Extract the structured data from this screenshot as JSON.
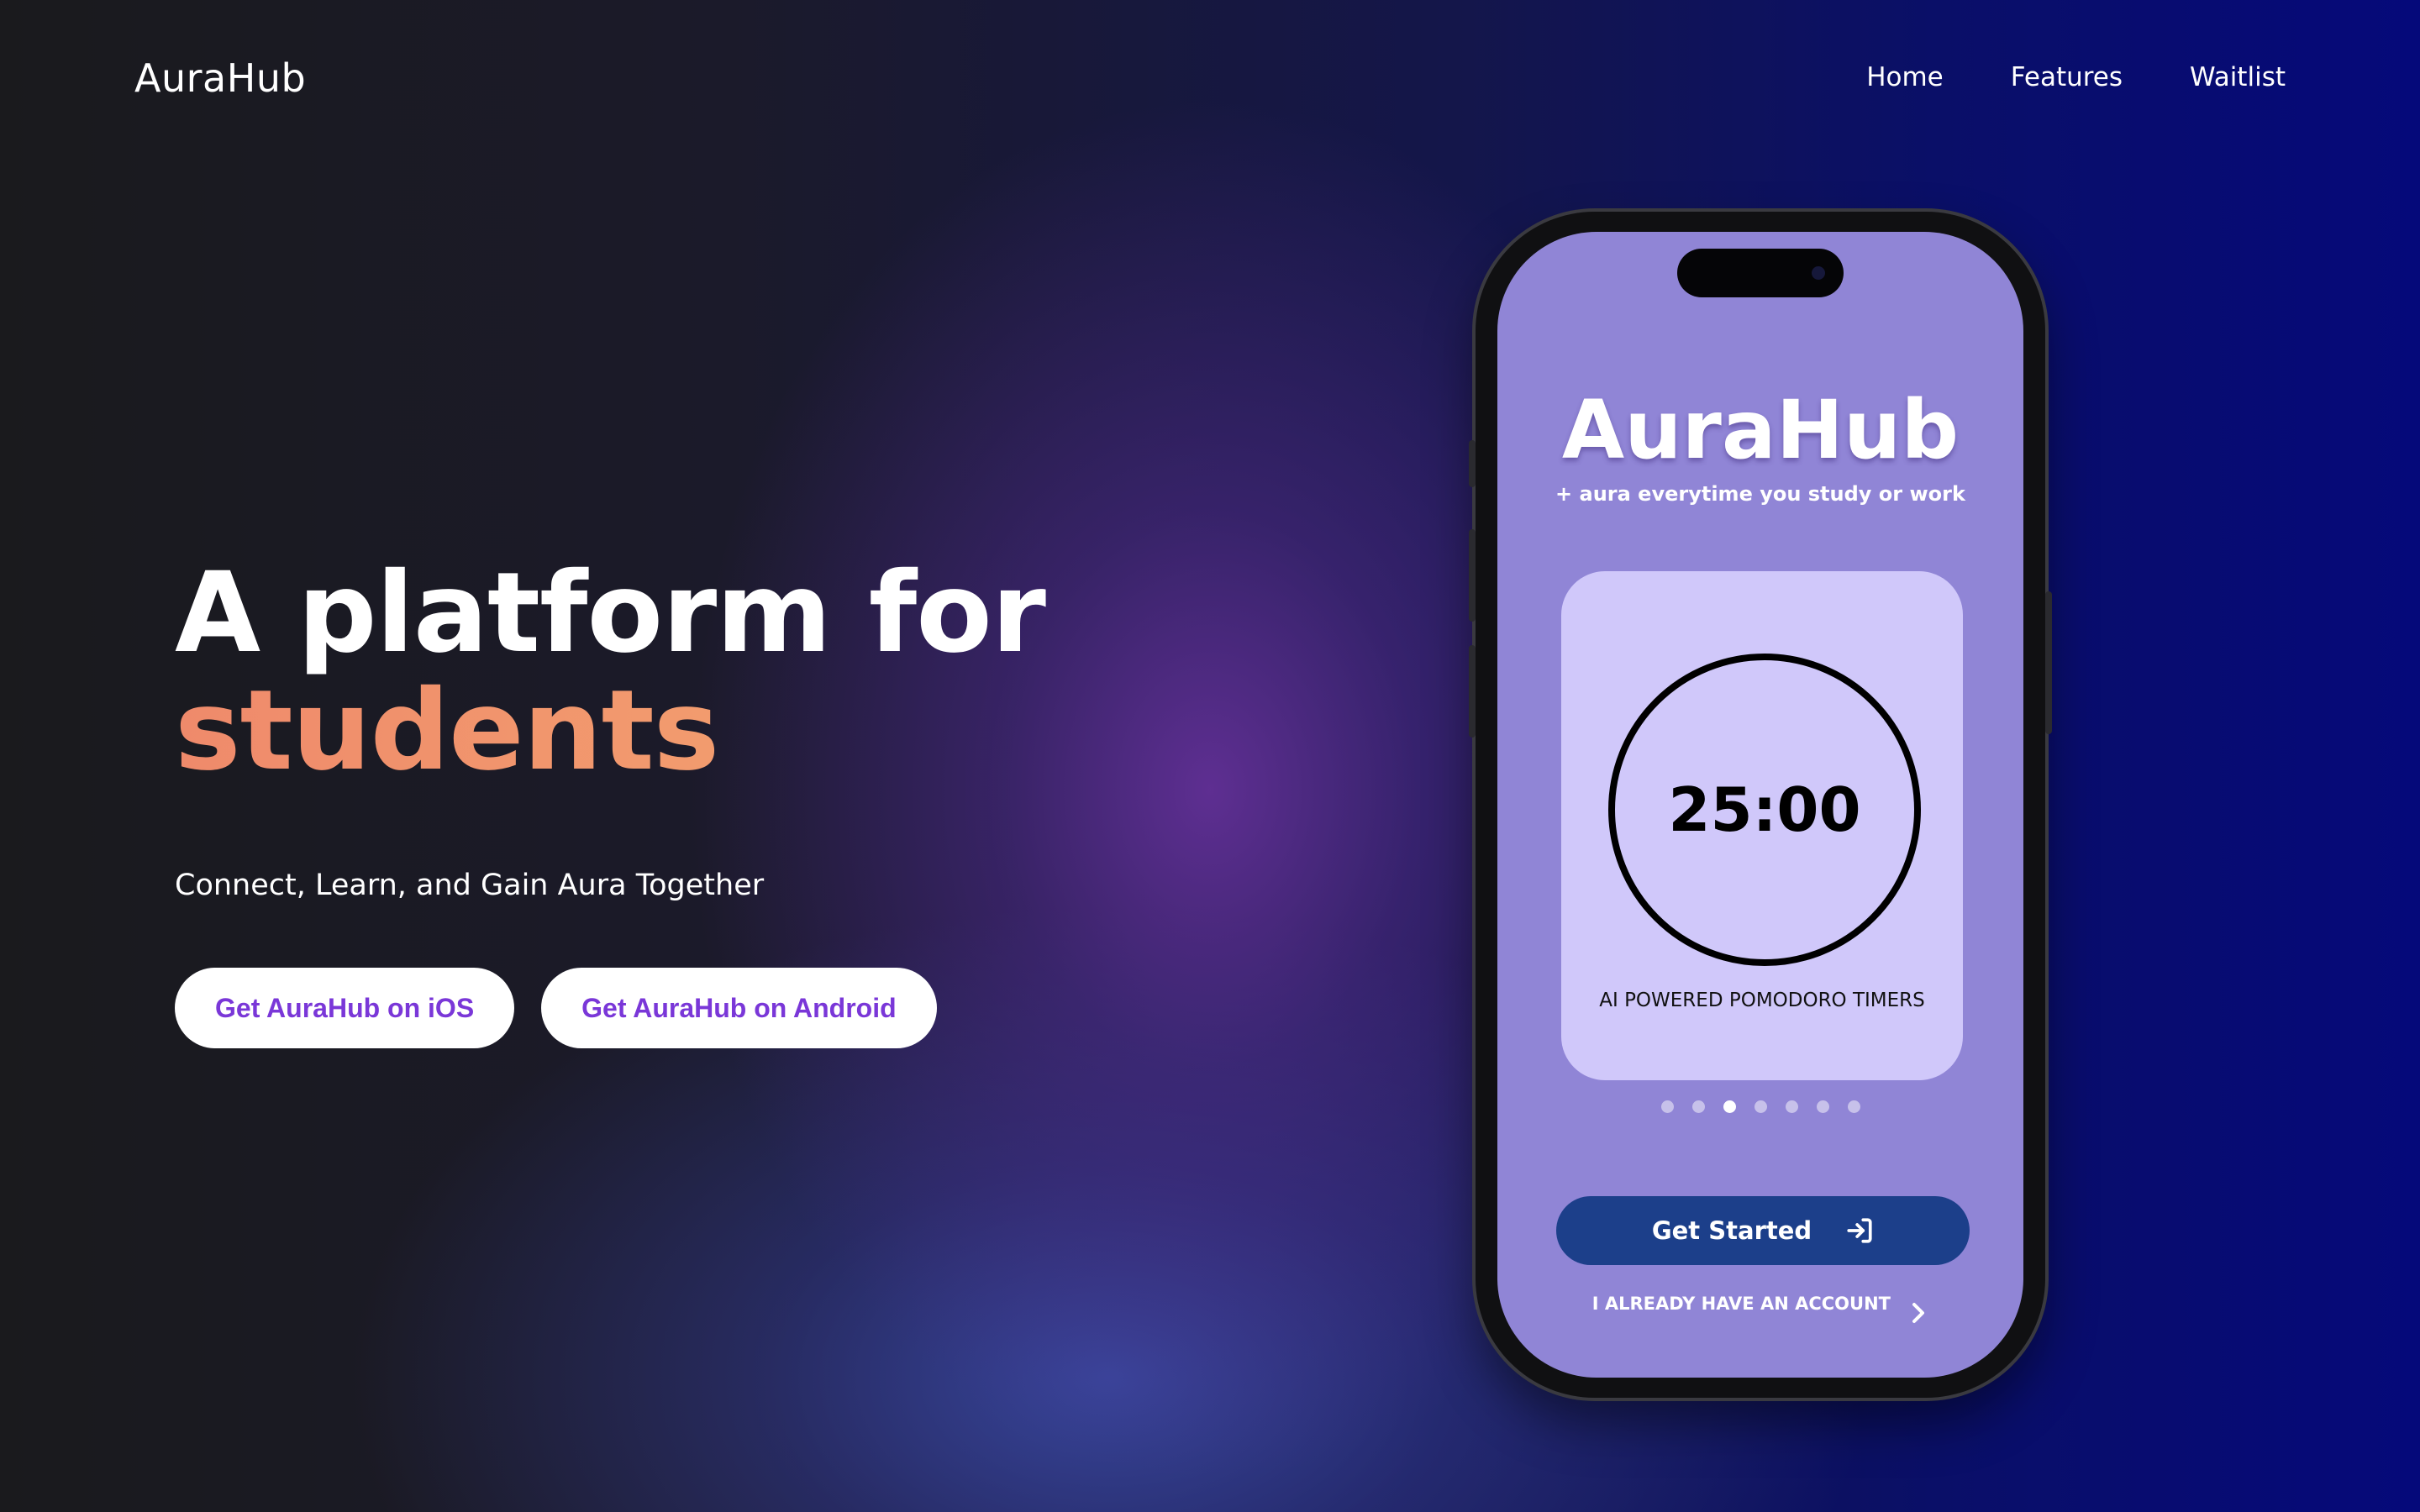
{
  "nav": {
    "logo": "AuraHub",
    "links": [
      "Home",
      "Features",
      "Waitlist"
    ]
  },
  "hero": {
    "title_line1": "A platform for",
    "title_line2": "students",
    "subtitle": "Connect, Learn, and Gain Aura Together",
    "cta_ios": "Get AuraHub on iOS",
    "cta_android": "Get AuraHub on Android"
  },
  "phone": {
    "app_title": "AuraHub",
    "tagline": "+ aura everytime you study or work",
    "timer": "25:00",
    "feature_caption": "AI POWERED POMODORO TIMERS",
    "carousel_total": 7,
    "carousel_active": 3,
    "get_started": "Get Started",
    "login_link": "I ALREADY HAVE AN ACCOUNT"
  },
  "colors": {
    "accent_gradient_start": "#ef8a6b",
    "accent_gradient_end": "#f4a670",
    "cta_text": "#7a37d8",
    "phone_screen": "#9085d6",
    "card": "#d0c8fa",
    "get_started_bg": "#1c3f8a"
  },
  "icons": {
    "get_started_icon": "login-arrow-icon",
    "login_link_icon": "chevron-right-icon"
  }
}
